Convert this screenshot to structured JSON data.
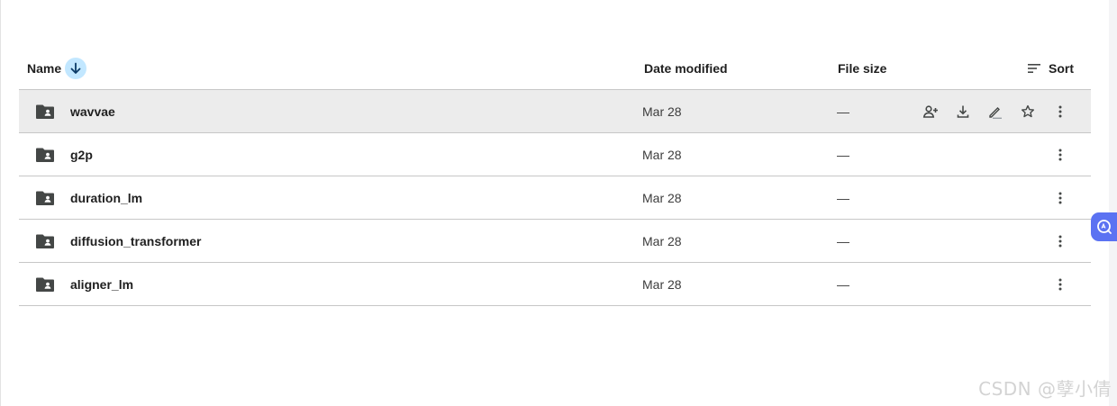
{
  "header": {
    "name_label": "Name",
    "date_label": "Date modified",
    "size_label": "File size",
    "sort_label": "Sort"
  },
  "rows": [
    {
      "name": "wavvae",
      "date": "Mar 28",
      "size": "—",
      "selected": true
    },
    {
      "name": "g2p",
      "date": "Mar 28",
      "size": "—",
      "selected": false
    },
    {
      "name": "duration_lm",
      "date": "Mar 28",
      "size": "—",
      "selected": false
    },
    {
      "name": "diffusion_transformer",
      "date": "Mar 28",
      "size": "—",
      "selected": false
    },
    {
      "name": "aligner_lm",
      "date": "Mar 28",
      "size": "—",
      "selected": false
    }
  ],
  "row_actions": [
    "share-icon",
    "download-icon",
    "rename-icon",
    "star-icon",
    "more-vert-icon"
  ],
  "icons": {
    "folder": "shared-folder-icon",
    "sort_direction": "arrow-down-icon",
    "sort_menu": "sort-lines-icon",
    "side_widget": "translate-icon"
  },
  "colors": {
    "selected_row": "#ececec",
    "sort_arrow_bg": "#c2e7ff",
    "side_widget": "#5b72f2"
  },
  "watermark": "CSDN @孽小倩"
}
